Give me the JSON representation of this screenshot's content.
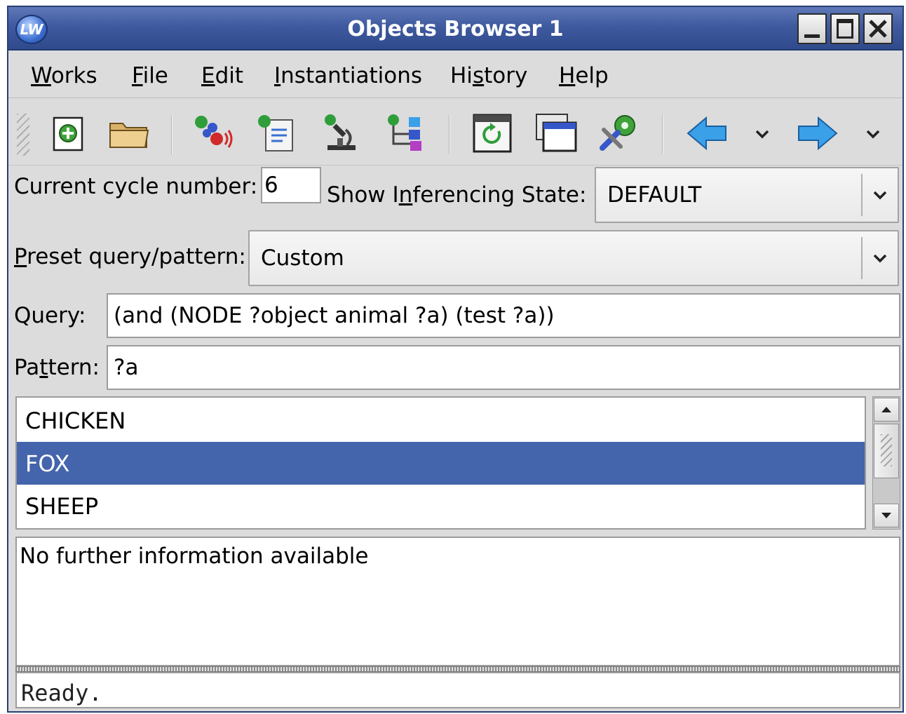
{
  "window": {
    "title": "Objects Browser 1",
    "app_icon_text": "LW",
    "buttons": {
      "minimize_icon": "minimize-icon",
      "maximize_icon": "maximize-icon",
      "close_icon": "close-icon"
    }
  },
  "menubar": {
    "items": [
      {
        "pre": "",
        "u": "W",
        "post": "orks"
      },
      {
        "pre": "",
        "u": "F",
        "post": "ile"
      },
      {
        "pre": "",
        "u": "E",
        "post": "dit"
      },
      {
        "pre": "",
        "u": "I",
        "post": "nstantiations"
      },
      {
        "pre": "Hi",
        "u": "s",
        "post": "tory"
      },
      {
        "pre": "",
        "u": "H",
        "post": "elp"
      }
    ]
  },
  "toolbar": {
    "icons": [
      "new-object-icon",
      "open-folder-icon",
      "nodes-signal-icon",
      "document-list-icon",
      "microscope-icon",
      "hierarchy-icon",
      "refresh-icon",
      "window-icon",
      "tools-gear-icon",
      "back-arrow-icon",
      "forward-arrow-icon"
    ],
    "accent_blue": "#3aa0e8"
  },
  "cycle": {
    "label": "Current cycle number:",
    "value": "6"
  },
  "inferencing": {
    "label_pre": "Show I",
    "label_u": "n",
    "label_post": "ferencing State:",
    "selected": "DEFAULT"
  },
  "preset": {
    "label_u": "P",
    "label_post": "reset query/pattern:",
    "selected": "Custom"
  },
  "query": {
    "label": "Query:",
    "value": "(and (NODE ?object animal ?a) (test ?a))"
  },
  "pattern": {
    "label_pre": "Pa",
    "label_u": "t",
    "label_post": "tern:",
    "value": "?a"
  },
  "results": {
    "items": [
      "CHICKEN",
      "FOX",
      "SHEEP"
    ],
    "selected_index": 1,
    "selection_color": "#4464ac"
  },
  "info": {
    "text": "No further information available"
  },
  "status": {
    "text": "Ready."
  }
}
